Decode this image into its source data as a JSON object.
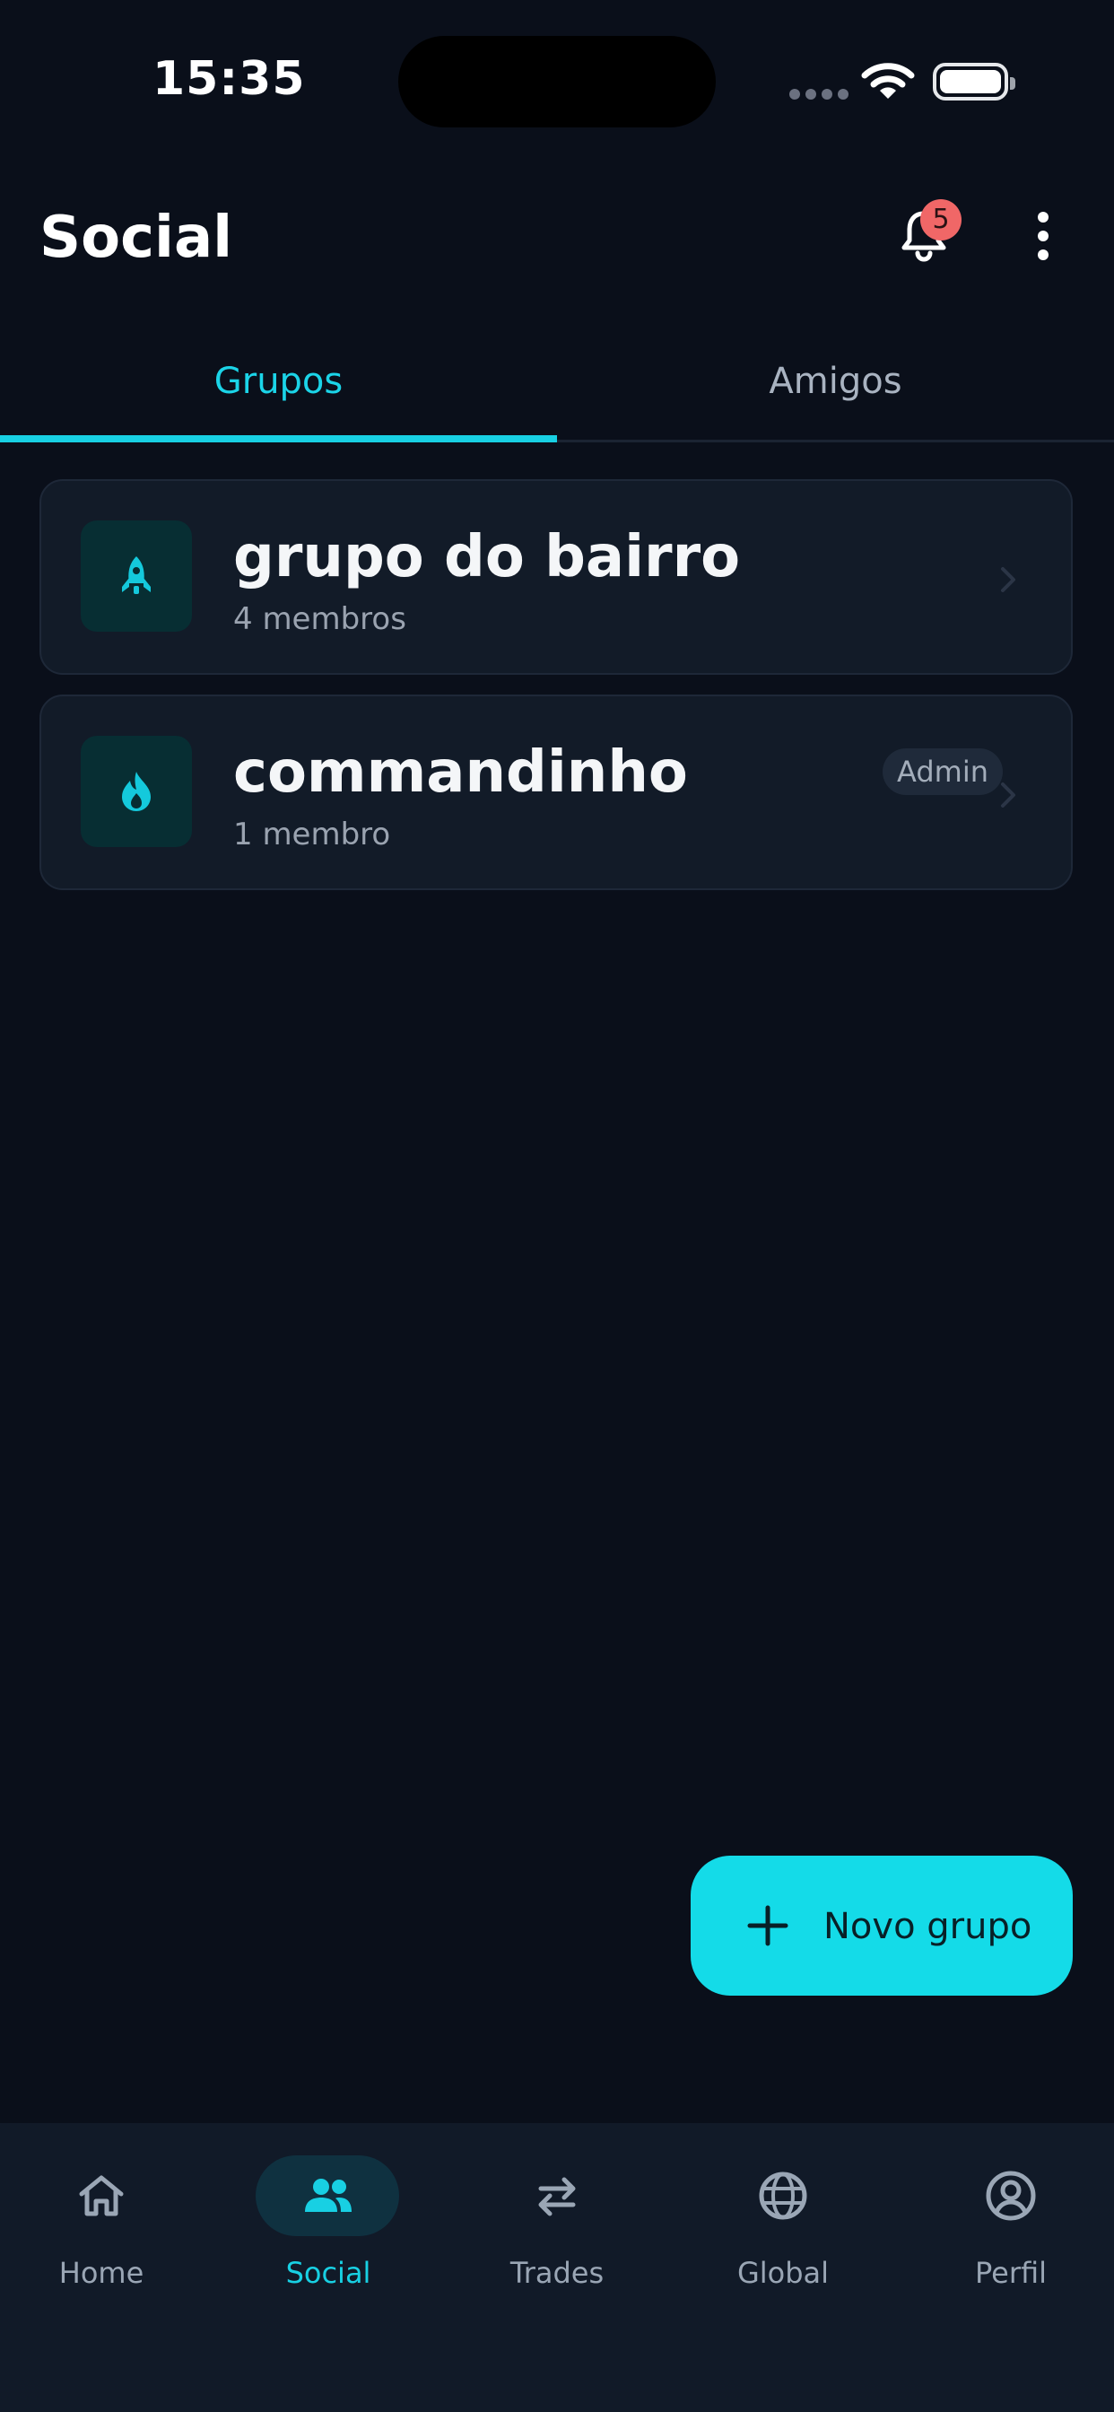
{
  "status_bar": {
    "time": "15:35"
  },
  "header": {
    "title": "Social",
    "notification_count": "5"
  },
  "tabs": [
    {
      "label": "Grupos",
      "active": true
    },
    {
      "label": "Amigos",
      "active": false
    }
  ],
  "groups": [
    {
      "name": "grupo do bairro",
      "members": "4 membros",
      "icon": "rocket-icon",
      "admin": ""
    },
    {
      "name": "commandinho",
      "members": "1 membro",
      "icon": "flame-icon",
      "admin": "Admin"
    }
  ],
  "fab": {
    "label": "Novo grupo"
  },
  "bottom_nav": [
    {
      "label": "Home",
      "icon": "home-icon",
      "active": false
    },
    {
      "label": "Social",
      "icon": "people-icon",
      "active": true
    },
    {
      "label": "Trades",
      "icon": "swap-icon",
      "active": false
    },
    {
      "label": "Global",
      "icon": "globe-icon",
      "active": false
    },
    {
      "label": "Perfil",
      "icon": "profile-icon",
      "active": false
    }
  ],
  "colors": {
    "accent": "#14dbe8",
    "background": "#0a0f1a",
    "card": "#121b28",
    "badge": "#f06767"
  }
}
